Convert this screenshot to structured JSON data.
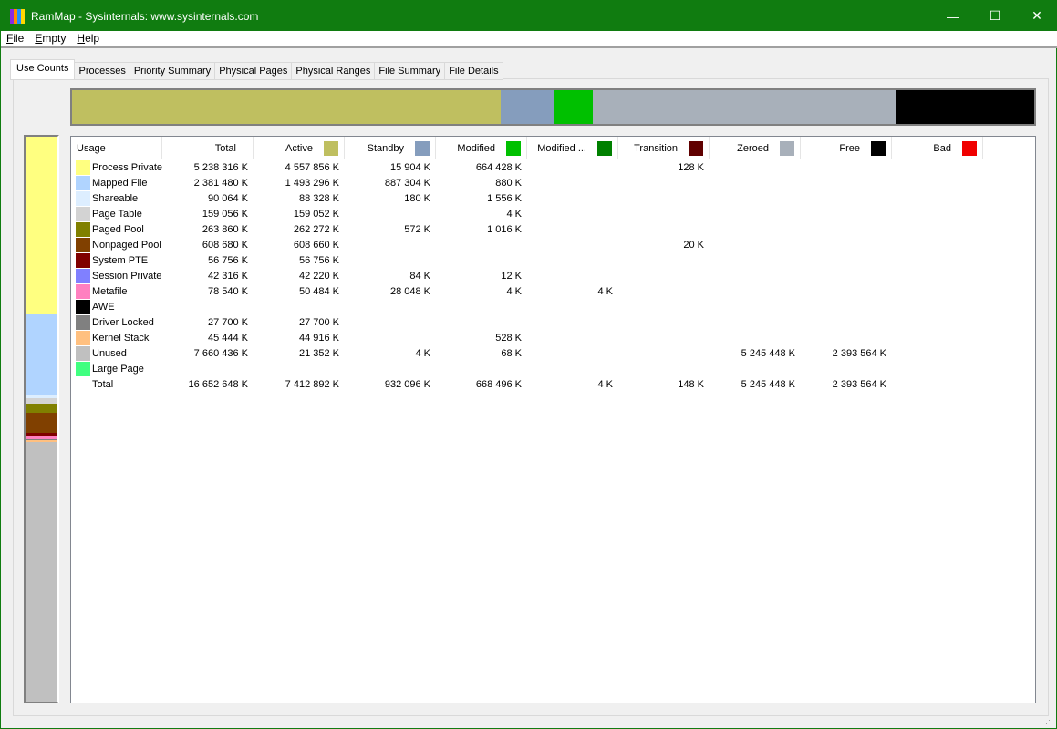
{
  "window": {
    "title": "RamMap - Sysinternals: www.sysinternals.com",
    "minimize": "—",
    "maximize": "☐",
    "close": "✕"
  },
  "menu": [
    {
      "label": "File",
      "key": "F",
      "rest": "ile"
    },
    {
      "label": "Empty",
      "key": "E",
      "rest": "mpty"
    },
    {
      "label": "Help",
      "key": "H",
      "rest": "elp"
    }
  ],
  "tabs": [
    "Use Counts",
    "Processes",
    "Priority Summary",
    "Physical Pages",
    "Physical Ranges",
    "File Summary",
    "File Details"
  ],
  "active_tab": "Use Counts",
  "columns": [
    {
      "label": "Usage"
    },
    {
      "label": "Total"
    },
    {
      "label": "Active",
      "color": "#bfbf60"
    },
    {
      "label": "Standby",
      "color": "#859dbd"
    },
    {
      "label": "Modified",
      "color": "#00c000"
    },
    {
      "label": "Modified ...",
      "color": "#008000"
    },
    {
      "label": "Transition",
      "color": "#600000"
    },
    {
      "label": "Zeroed",
      "color": "#a8b0ba"
    },
    {
      "label": "Free",
      "color": "#000000"
    },
    {
      "label": "Bad",
      "color": "#f00000"
    }
  ],
  "rows": [
    {
      "usage": "Process Private",
      "color": "#ffff80",
      "total_k": 5238316,
      "values": [
        "5 238 316 K",
        "4 557 856 K",
        "15 904 K",
        "664 428 K",
        "",
        "128 K",
        "",
        "",
        ""
      ]
    },
    {
      "usage": "Mapped File",
      "color": "#b0d4ff",
      "total_k": 2381480,
      "values": [
        "2 381 480 K",
        "1 493 296 K",
        "887 304 K",
        "880 K",
        "",
        "",
        "",
        "",
        ""
      ]
    },
    {
      "usage": "Shareable",
      "color": "#ddeeff",
      "total_k": 90064,
      "values": [
        "90 064 K",
        "88 328 K",
        "180 K",
        "1 556 K",
        "",
        "",
        "",
        "",
        ""
      ]
    },
    {
      "usage": "Page Table",
      "color": "#d3d3d3",
      "total_k": 159056,
      "values": [
        "159 056 K",
        "159 052 K",
        "",
        "4 K",
        "",
        "",
        "",
        "",
        ""
      ]
    },
    {
      "usage": "Paged Pool",
      "color": "#808000",
      "total_k": 263860,
      "values": [
        "263 860 K",
        "262 272 K",
        "572 K",
        "1 016 K",
        "",
        "",
        "",
        "",
        ""
      ]
    },
    {
      "usage": "Nonpaged Pool",
      "color": "#804000",
      "total_k": 608680,
      "values": [
        "608 680 K",
        "608 660 K",
        "",
        "",
        "",
        "20 K",
        "",
        "",
        ""
      ]
    },
    {
      "usage": "System PTE",
      "color": "#800000",
      "total_k": 56756,
      "values": [
        "56 756 K",
        "56 756 K",
        "",
        "",
        "",
        "",
        "",
        "",
        ""
      ]
    },
    {
      "usage": "Session Private",
      "color": "#8080ff",
      "total_k": 42316,
      "values": [
        "42 316 K",
        "42 220 K",
        "84 K",
        "12 K",
        "",
        "",
        "",
        "",
        ""
      ]
    },
    {
      "usage": "Metafile",
      "color": "#ff80c0",
      "total_k": 78540,
      "values": [
        "78 540 K",
        "50 484 K",
        "28 048 K",
        "4 K",
        "4 K",
        "",
        "",
        "",
        ""
      ]
    },
    {
      "usage": "AWE",
      "color": "#000000",
      "total_k": 0,
      "values": [
        "",
        "",
        "",
        "",
        "",
        "",
        "",
        "",
        ""
      ]
    },
    {
      "usage": "Driver Locked",
      "color": "#808080",
      "total_k": 27700,
      "values": [
        "27 700 K",
        "27 700 K",
        "",
        "",
        "",
        "",
        "",
        "",
        ""
      ]
    },
    {
      "usage": "Kernel Stack",
      "color": "#ffc080",
      "total_k": 45444,
      "values": [
        "45 444 K",
        "44 916 K",
        "",
        "528 K",
        "",
        "",
        "",
        "",
        ""
      ]
    },
    {
      "usage": "Unused",
      "color": "#c0c0c0",
      "total_k": 7660436,
      "values": [
        "7 660 436 K",
        "21 352 K",
        "4 K",
        "68 K",
        "",
        "",
        "5 245 448 K",
        "2 393 564 K",
        ""
      ]
    },
    {
      "usage": "Large Page",
      "color": "#40ff80",
      "total_k": 0,
      "values": [
        "",
        "",
        "",
        "",
        "",
        "",
        "",
        "",
        ""
      ]
    },
    {
      "usage": "Total",
      "color": null,
      "total_k": 16652648,
      "values": [
        "16 652 648 K",
        "7 412 892 K",
        "932 096 K",
        "668 496 K",
        "4 K",
        "148 K",
        "5 245 448 K",
        "2 393 564 K",
        ""
      ]
    }
  ],
  "state_bar": [
    {
      "state": "Active",
      "value_k": 7412892,
      "color": "#bfbf60"
    },
    {
      "state": "Standby",
      "value_k": 932096,
      "color": "#859dbd"
    },
    {
      "state": "Modified",
      "value_k": 668496,
      "color": "#00c000"
    },
    {
      "state": "Modified ...",
      "value_k": 4,
      "color": "#008000"
    },
    {
      "state": "Transition",
      "value_k": 148,
      "color": "#600000"
    },
    {
      "state": "Zeroed",
      "value_k": 5245448,
      "color": "#a8b0ba"
    },
    {
      "state": "Free",
      "value_k": 2393564,
      "color": "#000000"
    }
  ]
}
